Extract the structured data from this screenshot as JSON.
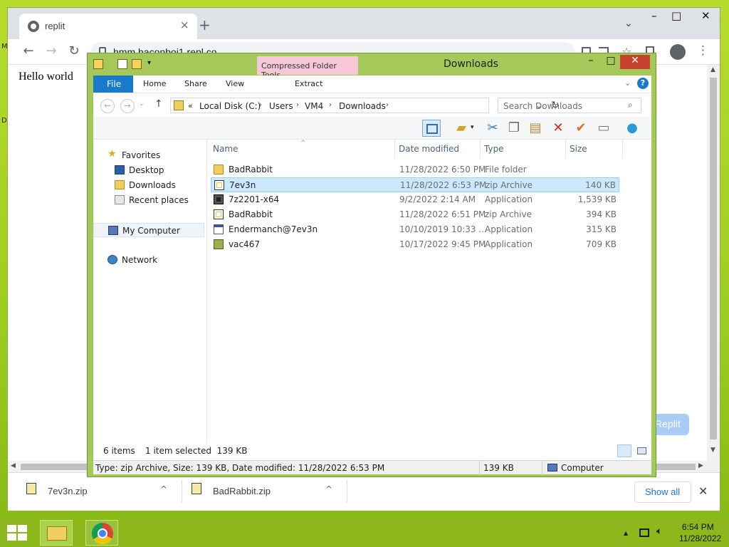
{
  "desktop": {
    "edge_glyph_top": "M",
    "edge_glyph_mid": "D"
  },
  "chrome": {
    "tab_title": "replit",
    "tab_close": "×",
    "new_tab": "+",
    "minimize": "–",
    "maximize": "□",
    "close": "✕",
    "tab_dropdown": "⌄",
    "url": "hmm.baconboi1.repl.co",
    "back": "←",
    "forward": "→",
    "reload": "↻",
    "menu": "⋮",
    "page_text": "Hello world",
    "page_button": "Replit",
    "downloads": [
      {
        "name": "7ev3n.zip",
        "caret": "^"
      },
      {
        "name": "BadRabbit.zip",
        "caret": "^"
      }
    ],
    "show_all": "Show all",
    "downloads_close": "✕"
  },
  "explorer": {
    "title": "Downloads",
    "context_tab": "Compressed Folder Tools",
    "ribbon_tabs": {
      "file": "File",
      "home": "Home",
      "share": "Share",
      "view": "View",
      "extract": "Extract"
    },
    "window_controls": {
      "minimize": "–",
      "maximize": "□",
      "close": "✕"
    },
    "help": "?",
    "ribbon_chevron": "⌄",
    "nav": {
      "back": "←",
      "forward": "→",
      "recent": "⌄",
      "up": "↑"
    },
    "breadcrumb": {
      "overflow": "«",
      "items": [
        "Local Disk (C:)",
        "Users",
        "VM4",
        "Downloads"
      ],
      "sep": "›"
    },
    "address_dropdown": "⌄",
    "refresh": "↻",
    "search_placeholder": "Search Downloads",
    "search_icon": "⌕",
    "nav_pane": {
      "favorites": "Favorites",
      "desktop": "Desktop",
      "downloads": "Downloads",
      "recent_places": "Recent places",
      "computer": "My Computer",
      "network": "Network"
    },
    "columns": {
      "name": "Name",
      "date": "Date modified",
      "type": "Type",
      "size": "Size",
      "sort_caret": "^"
    },
    "files": [
      {
        "name": "BadRabbit",
        "date": "11/28/2022 6:50 PM",
        "type": "File folder",
        "size": "",
        "icon": "folder-icon"
      },
      {
        "name": "7ev3n",
        "date": "11/28/2022 6:53 PM",
        "type": "zip Archive",
        "size": "140 KB",
        "icon": "zip-icon",
        "selected": true
      },
      {
        "name": "7z2201-x64",
        "date": "9/2/2022 2:14 AM",
        "type": "Application",
        "size": "1,539 KB",
        "icon": "7zip-app-icon"
      },
      {
        "name": "BadRabbit",
        "date": "11/28/2022 6:51 PM",
        "type": "zip Archive",
        "size": "394 KB",
        "icon": "zip-icon"
      },
      {
        "name": "Endermanch@7ev3n",
        "date": "10/10/2019 10:33 ...",
        "type": "Application",
        "size": "315 KB",
        "icon": "application-icon"
      },
      {
        "name": "vac467",
        "date": "10/17/2022 9:45 PM",
        "type": "Application",
        "size": "709 KB",
        "icon": "application-icon"
      }
    ],
    "status": {
      "item_count": "6 items",
      "selection": "1 item selected  139 KB"
    },
    "statusbar": {
      "details": "Type: zip Archive, Size: 139 KB, Date modified: 11/28/2022 6:53 PM",
      "size": "139 KB",
      "location": "Computer"
    }
  },
  "taskbar": {
    "tray_chevron": "▲",
    "time": "6:54 PM",
    "date": "11/28/2022"
  },
  "colors": {
    "desktop": "#9ccc20",
    "explorer_frame": "#a4c85a",
    "accent": "#1979ca",
    "selection": "#cce8ff",
    "close": "#c7412c"
  }
}
